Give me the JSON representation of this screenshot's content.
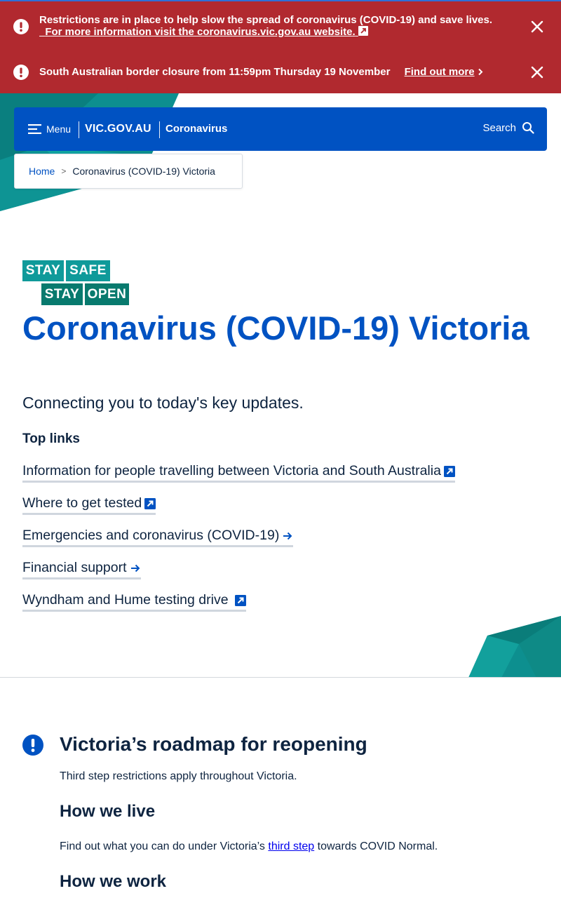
{
  "alerts": [
    {
      "text": "Restrictions are in place to help slow the spread of coronavirus (COVID-19) and save lives.",
      "link": "For more information visit the coronavirus.vic.gov.au website."
    },
    {
      "text": "South Australian border closure from 11:59pm Thursday 19 November",
      "link": "Find out more"
    }
  ],
  "header": {
    "menu_label": "Menu",
    "brand": "VIC.GOV.AU",
    "site_name": "Coronavirus",
    "search_label": "Search"
  },
  "breadcrumb": {
    "home": "Home",
    "separator": ">",
    "current": "Coronavirus (COVID-19) Victoria"
  },
  "logo": {
    "stay1": "STAY",
    "safe": "SAFE",
    "stay2": "STAY",
    "open": "OPEN"
  },
  "hero": {
    "title": "Coronavirus (COVID-19) Victoria",
    "lede": "Connecting you to today's key updates.",
    "top_links_heading": "Top links"
  },
  "top_links": [
    {
      "label": "Information for people travelling between Victoria and South Australia",
      "icon": "external-link-icon"
    },
    {
      "label": "Where to get tested",
      "icon": "external-link-icon"
    },
    {
      "label": "Emergencies and coronavirus (COVID-19)",
      "icon": "arrow-right-icon"
    },
    {
      "label": "Financial support",
      "icon": "arrow-right-icon"
    },
    {
      "label": "Wyndham and Hume testing drive",
      "icon": "external-link-icon"
    }
  ],
  "roadmap": {
    "title": "Victoria’s roadmap for reopening",
    "subtitle": "Third step restrictions apply throughout Victoria.",
    "how_we_live": "How we live",
    "live_text_before": "Find out what you can do under Victoria’s",
    "live_link": "third step",
    "live_text_after": "towards COVID Normal.",
    "how_we_work": "How we work"
  },
  "colors": {
    "alert_red": "#b1292f",
    "brand_blue": "#0052c2",
    "teal": "#0f9a9a",
    "dark_teal": "#087a6e",
    "navy_text": "#0e2440"
  }
}
